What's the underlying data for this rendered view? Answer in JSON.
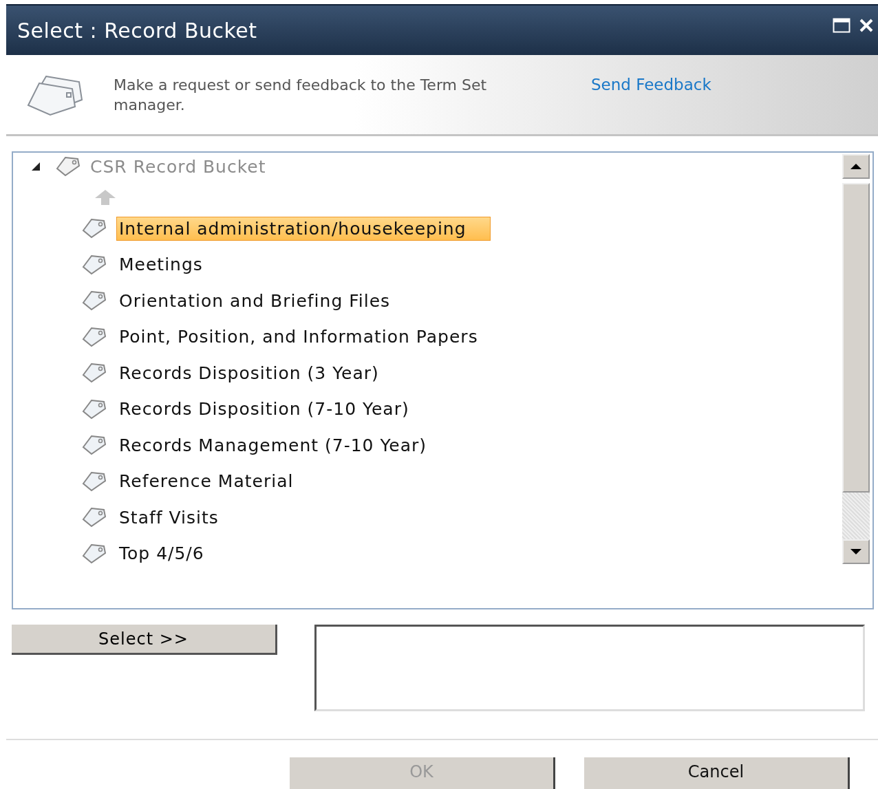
{
  "window": {
    "title": "Select : Record Bucket"
  },
  "feedback": {
    "message": "Make a request or send feedback to the Term Set manager.",
    "link": "Send Feedback"
  },
  "tree": {
    "root": {
      "label": "CSR Record Bucket",
      "expanded": true,
      "children": [
        {
          "label": "Internal administration/housekeeping",
          "selected": true
        },
        {
          "label": "Meetings",
          "selected": false
        },
        {
          "label": "Orientation and Briefing Files",
          "selected": false
        },
        {
          "label": "Point, Position, and Information Papers",
          "selected": false
        },
        {
          "label": "Records Disposition (3 Year)",
          "selected": false
        },
        {
          "label": "Records Disposition (7-10 Year)",
          "selected": false
        },
        {
          "label": "Records Management (7-10 Year)",
          "selected": false
        },
        {
          "label": "Reference Material",
          "selected": false
        },
        {
          "label": "Staff Visits",
          "selected": false
        },
        {
          "label": "Top 4/5/6",
          "selected": false
        }
      ]
    }
  },
  "select_button": "Select >>",
  "buttons": [
    {
      "label": "OK",
      "disabled": true
    },
    {
      "label": "Cancel",
      "disabled": false
    }
  ]
}
